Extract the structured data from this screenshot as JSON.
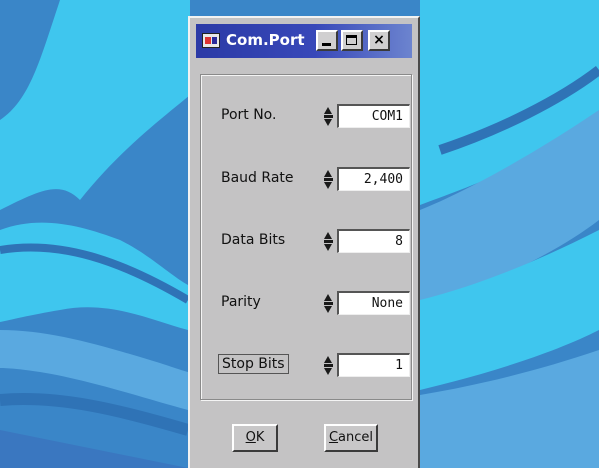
{
  "window": {
    "title": "Com.Port",
    "close_glyph": "×"
  },
  "fields": [
    {
      "label": "Port No.",
      "value": "COM1"
    },
    {
      "label": "Baud Rate",
      "value": "2,400"
    },
    {
      "label": "Data Bits",
      "value": "8"
    },
    {
      "label": "Parity",
      "value": "None"
    },
    {
      "label": "Stop Bits",
      "value": "1"
    }
  ],
  "buttons": {
    "ok": {
      "mnemonic": "O",
      "rest": "K"
    },
    "cancel": {
      "mnemonic": "C",
      "rest": "ancel"
    }
  },
  "colors": {
    "titlebar": "#2b3aa6",
    "desktop_light": "#3fc6ee",
    "desktop_dark": "#3a86c8"
  }
}
